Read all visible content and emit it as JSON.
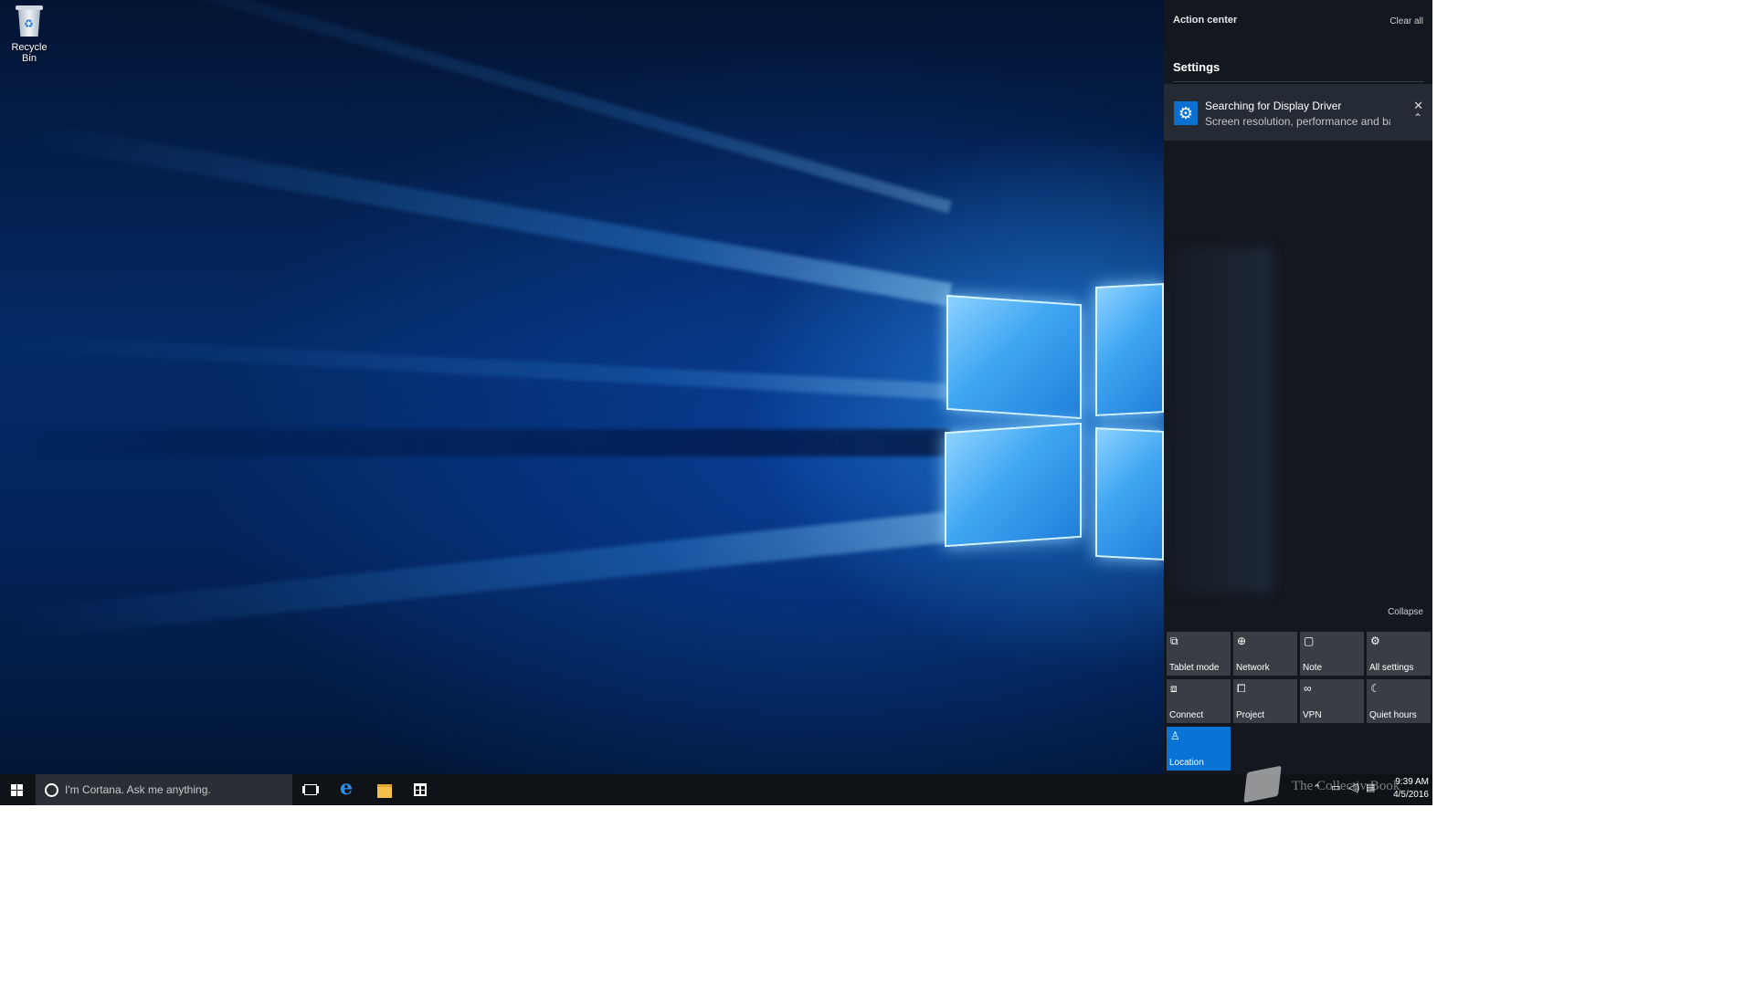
{
  "desktop": {
    "icons": [
      {
        "label": "Recycle Bin",
        "icon": "recycle-bin-icon"
      }
    ]
  },
  "action_center": {
    "title": "Action center",
    "clear_all": "Clear all",
    "group_title": "Settings",
    "notification": {
      "icon": "gear-icon",
      "title": "Searching for Display Driver",
      "body": "Screen resolution, performance and battery life may be affected"
    },
    "collapse": "Collapse",
    "quick_actions": [
      {
        "label": "Tablet mode",
        "icon": "tablet-mode-icon",
        "glyph": "⧉",
        "active": false
      },
      {
        "label": "Network",
        "icon": "network-globe-icon",
        "glyph": "⊕",
        "active": false
      },
      {
        "label": "Note",
        "icon": "note-icon",
        "glyph": "▢",
        "active": false
      },
      {
        "label": "All settings",
        "icon": "gear-icon",
        "glyph": "⚙",
        "active": false
      },
      {
        "label": "Connect",
        "icon": "connect-icon",
        "glyph": "⧈",
        "active": false
      },
      {
        "label": "Project",
        "icon": "project-icon",
        "glyph": "⧠",
        "active": false
      },
      {
        "label": "VPN",
        "icon": "vpn-icon",
        "glyph": "∞",
        "active": false
      },
      {
        "label": "Quiet hours",
        "icon": "moon-icon",
        "glyph": "☾",
        "active": false
      },
      {
        "label": "Location",
        "icon": "location-icon",
        "glyph": "♙",
        "active": true
      }
    ],
    "colors": {
      "accent": "#0a74d6",
      "tile": "#3a3e44",
      "panel": "#14181e"
    }
  },
  "taskbar": {
    "search_placeholder": "I'm Cortana. Ask me anything.",
    "pinned": [
      "task-view-icon",
      "edge-icon",
      "file-explorer-icon",
      "store-icon"
    ],
    "edge_glyph": "e",
    "tray": {
      "chevron": "⌃",
      "network": "▭",
      "volume": "◁)",
      "messages": "▤"
    },
    "time": "9:39 AM",
    "date": "4/5/2016"
  },
  "watermark": {
    "text": "The Collectiv Book"
  }
}
